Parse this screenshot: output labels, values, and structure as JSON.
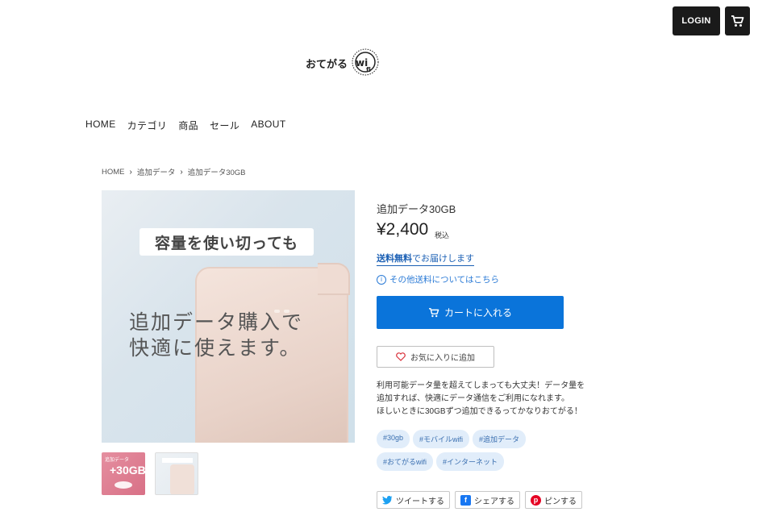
{
  "header": {
    "login_label": "LOGIN",
    "cart_icon": "cart-icon",
    "logo_text": "おてがるwifi"
  },
  "nav": {
    "items": [
      {
        "label": "HOME"
      },
      {
        "label": "カテゴリ"
      },
      {
        "label": "商品"
      },
      {
        "label": "セール"
      },
      {
        "label": "ABOUT"
      }
    ]
  },
  "breadcrumb": {
    "items": [
      "HOME",
      "追加データ",
      "追加データ30GB"
    ]
  },
  "main_image": {
    "headline": "容量を使い切っても",
    "overlay_line1": "追加データ購入で",
    "overlay_line2": "快適に使えます。"
  },
  "thumbnails": [
    {
      "label_small": "追加データ",
      "label_big": "+30GB"
    },
    {
      "label_small": ""
    }
  ],
  "product": {
    "title": "追加データ30GB",
    "price": "¥2,400",
    "tax_label": "税込",
    "shipping_free_strong": "送料無料",
    "shipping_free_rest": "でお届けします",
    "other_shipping": "その他送料についてはこちら",
    "add_to_cart": "カートに入れる",
    "favorite": "お気に入りに追加",
    "description": [
      "利用可能データ量を超えてしまっても大丈夫！データ量を",
      "追加すれば、快適にデータ通信をご利用になれます。",
      "ほしいときに30GBずつ追加できるってかなりおてがる！"
    ]
  },
  "tags": [
    "#30gb",
    "#モバイルwifi",
    "#追加データ",
    "#おてがるwifi",
    "#インターネット"
  ],
  "share": {
    "tweet": "ツイートする",
    "facebook": "シェアする",
    "pinterest": "ピンする"
  },
  "colors": {
    "primary_button": "#0a74da",
    "dark_button": "#1a1a1a",
    "link": "#1a5fb4",
    "tag_bg": "#e1edfa"
  }
}
